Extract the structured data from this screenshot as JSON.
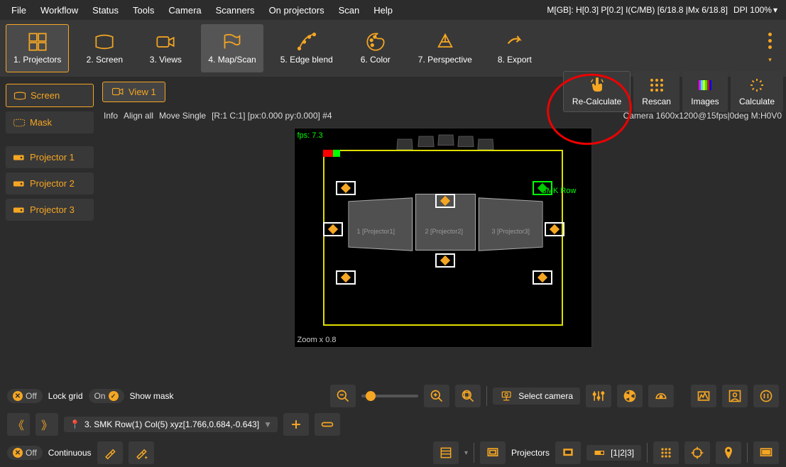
{
  "menu": {
    "items": [
      "File",
      "Workflow",
      "Status",
      "Tools",
      "Camera",
      "Scanners",
      "On projectors",
      "Scan",
      "Help"
    ],
    "status": "M[GB]: H[0.3] P[0.2] I(C/MB) [6/18.8 |Mx 6/18.8]",
    "dpi": "DPI 100%"
  },
  "toolbar": {
    "items": [
      {
        "label": "1. Projectors"
      },
      {
        "label": "2. Screen"
      },
      {
        "label": "3. Views"
      },
      {
        "label": "4. Map/Scan"
      },
      {
        "label": "5. Edge blend"
      },
      {
        "label": "6. Color"
      },
      {
        "label": "7. Perspective"
      },
      {
        "label": "8. Export"
      }
    ]
  },
  "sidebar": {
    "screen": "Screen",
    "mask": "Mask",
    "projectors": [
      "Projector 1",
      "Projector 2",
      "Projector 3"
    ]
  },
  "viewtab": "View 1",
  "actions": {
    "recalc": "Re-Calculate",
    "rescan": "Rescan",
    "images": "Images",
    "calculate": "Calculate"
  },
  "infobar": {
    "info": "Info",
    "align": "Align all",
    "move": "Move Single",
    "coords": "[R:1 C:1] [px:0.000 py:0.000] #4",
    "camera": "Camera 1600x1200@15fps|0deg M:H0V0"
  },
  "viewport": {
    "fps": "fps: 7.3",
    "zoom": "Zoom x 0.8",
    "smk": "SMK Row",
    "p1": "1 [Projector1]",
    "p2": "2 [Projector2]",
    "p3": "3 [Projector3]"
  },
  "row1": {
    "off": "Off",
    "lockgrid": "Lock grid",
    "on": "On",
    "showmask": "Show mask",
    "selectcam": "Select camera"
  },
  "row2": {
    "selector": "3. SMK Row(1) Col(5) xyz[1.766,0.684,-0.643]"
  },
  "row3": {
    "off": "Off",
    "continuous": "Continuous",
    "projectors": "Projectors",
    "p123": "[1|2|3]"
  }
}
